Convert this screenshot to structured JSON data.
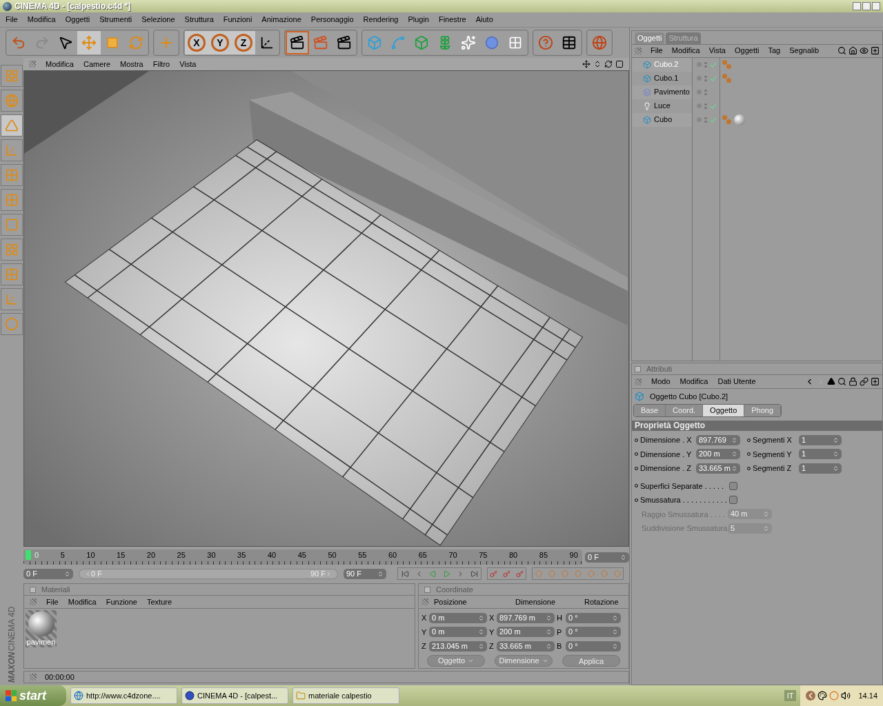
{
  "window": {
    "title": "CINEMA 4D - [calpestio.c4d *]"
  },
  "menu": [
    "File",
    "Modifica",
    "Oggetti",
    "Strumenti",
    "Selezione",
    "Struttura",
    "Funzioni",
    "Animazione",
    "Personaggio",
    "Rendering",
    "Plugin",
    "Finestre",
    "Aiuto"
  ],
  "toolbar": {
    "axis_buttons": [
      "X",
      "Y",
      "Z"
    ]
  },
  "viewport": {
    "menu": [
      "Modifica",
      "Camere",
      "Mostra",
      "Filtro",
      "Vista"
    ]
  },
  "timeline": {
    "ticks": [
      "0",
      "5",
      "10",
      "15",
      "20",
      "25",
      "30",
      "35",
      "40",
      "45",
      "50",
      "55",
      "60",
      "65",
      "70",
      "75",
      "80",
      "85",
      "90"
    ],
    "current_frame": "0 F",
    "start": "0 F",
    "range": {
      "start": "0 F",
      "end": "90 F",
      "level": 1
    },
    "end": "90 F"
  },
  "materials": {
    "title": "Materiali",
    "menu": [
      "File",
      "Modifica",
      "Funzione",
      "Texture"
    ],
    "items": [
      {
        "name": "pavimen"
      }
    ]
  },
  "coordinates": {
    "title": "Coordinate",
    "headers": [
      "Posizione",
      "Dimensione",
      "Rotazione"
    ],
    "rows": [
      {
        "pos_axis": "X",
        "pos": "0 m",
        "dim_axis": "X",
        "dim": "897.769 m",
        "rot_axis": "H",
        "rot": "0 °"
      },
      {
        "pos_axis": "Y",
        "pos": "0 m",
        "dim_axis": "Y",
        "dim": "200 m",
        "rot_axis": "P",
        "rot": "0 °"
      },
      {
        "pos_axis": "Z",
        "pos": "213.045 m",
        "dim_axis": "Z",
        "dim": "33.665 m",
        "rot_axis": "B",
        "rot": "0 °"
      }
    ],
    "dropdowns": [
      "Oggetto",
      "Dimensione"
    ],
    "apply": "Applica"
  },
  "status_bar": {
    "time": "00:00:00"
  },
  "brand": {
    "maker": "MAXON",
    "product": "CINEMA 4D"
  },
  "objects": {
    "tabs": [
      {
        "label": "Oggetti",
        "selected": true
      },
      {
        "label": "Struttura",
        "selected": false
      }
    ],
    "menu": [
      "File",
      "Modifica",
      "Vista",
      "Oggetti",
      "Tag",
      "Segnalib"
    ],
    "items": [
      {
        "name": "Cubo.2",
        "kind": "cube",
        "selected": true,
        "enabled": true,
        "texture_tag": true,
        "material_tag": false
      },
      {
        "name": "Cubo.1",
        "kind": "cube",
        "selected": false,
        "enabled": true,
        "texture_tag": true,
        "material_tag": false
      },
      {
        "name": "Pavimento",
        "kind": "floor",
        "selected": false,
        "enabled": false,
        "texture_tag": false,
        "material_tag": false
      },
      {
        "name": "Luce",
        "kind": "light",
        "selected": false,
        "enabled": true,
        "texture_tag": false,
        "material_tag": false
      },
      {
        "name": "Cubo",
        "kind": "cube",
        "selected": false,
        "enabled": true,
        "texture_tag": true,
        "material_tag": true
      }
    ]
  },
  "attributes": {
    "title": "Attributi",
    "menu": [
      "Modo",
      "Modifica",
      "Dati Utente"
    ],
    "object": "Oggetto Cubo [Cubo.2]",
    "tabs": [
      {
        "label": "Base",
        "selected": false
      },
      {
        "label": "Coord.",
        "selected": false
      },
      {
        "label": "Oggetto",
        "selected": true
      },
      {
        "label": "Phong",
        "selected": false
      }
    ],
    "section": "Proprietà Oggetto",
    "fields": [
      {
        "label": "Dimensione . X",
        "value": "897.769",
        "seg_label": "Segmenti X",
        "seg_value": "1"
      },
      {
        "label": "Dimensione . Y",
        "value": "200 m",
        "seg_label": "Segmenti Y",
        "seg_value": "1"
      },
      {
        "label": "Dimensione . Z",
        "value": "33.665 m",
        "seg_label": "Segmenti Z",
        "seg_value": "1"
      }
    ],
    "options": [
      {
        "label": "Superfici Separate . . . . .",
        "checked": false
      },
      {
        "label": "Smussatura . . . . . . . . . . .",
        "checked": false
      }
    ],
    "disabled_fields": [
      {
        "label": "Raggio Smussatura . . . .",
        "value": "40 m"
      },
      {
        "label": "Suddivisione Smussatura",
        "value": "5"
      }
    ]
  },
  "taskbar": {
    "start": "start",
    "tasks": [
      {
        "label": "http://www.c4dzone....",
        "kind": "browser"
      },
      {
        "label": "CINEMA 4D - [calpest...",
        "kind": "app"
      },
      {
        "label": "materiale calpestio",
        "kind": "folder"
      }
    ],
    "language": "IT",
    "clock": "14.14"
  }
}
